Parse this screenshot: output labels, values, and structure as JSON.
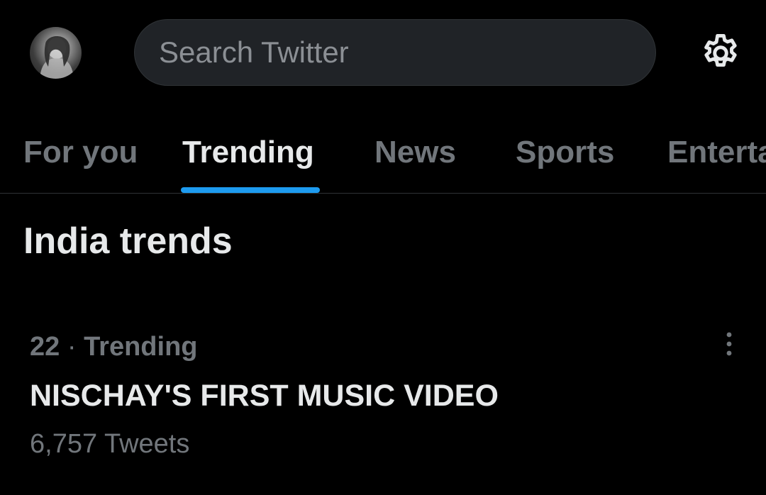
{
  "search": {
    "placeholder": "Search Twitter"
  },
  "tabs": [
    {
      "label": "For you"
    },
    {
      "label": "Trending"
    },
    {
      "label": "News"
    },
    {
      "label": "Sports"
    },
    {
      "label": "Entertainment"
    }
  ],
  "active_tab": "Trending",
  "section": {
    "title": "India trends"
  },
  "trends": [
    {
      "rank": "22",
      "separator": "·",
      "category": "Trending",
      "name": "NISCHAY'S FIRST MUSIC VIDEO",
      "count": "6,757 Tweets"
    }
  ],
  "icons": {
    "avatar": "profile-avatar",
    "settings": "gear-icon",
    "more": "more-vertical-icon"
  },
  "colors": {
    "background": "#000000",
    "accent": "#1d9bf0",
    "text_primary": "#e7e9ea",
    "text_secondary": "#71767b",
    "search_bg": "#202327"
  }
}
